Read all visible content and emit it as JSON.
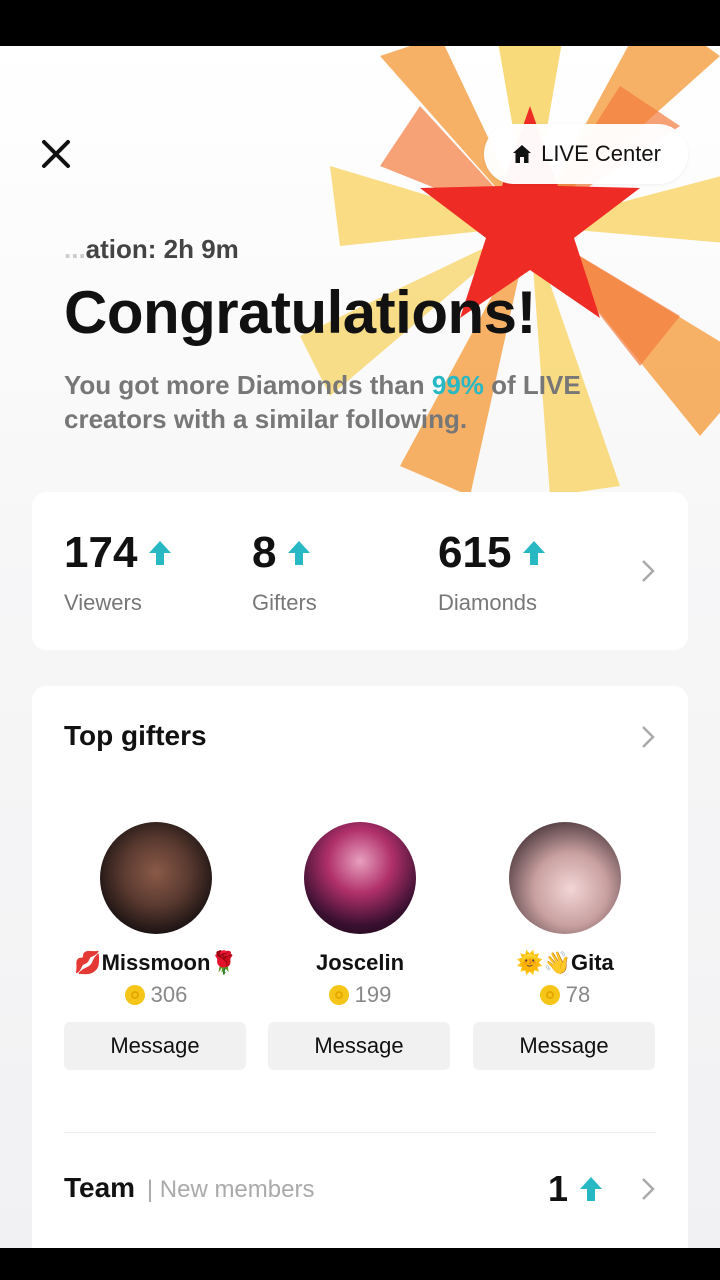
{
  "header": {
    "live_center_label": "LIVE Center",
    "duration_prefix_cut": "...",
    "duration_text": "ation: 2h 9m",
    "title": "Congratulations!",
    "subtitle_part1": "You got more Diamonds than ",
    "subtitle_pct": "99%",
    "subtitle_part2": " of LIVE creators with a similar following."
  },
  "stats": {
    "viewers": {
      "value": "174",
      "label": "Viewers"
    },
    "gifters": {
      "value": "8",
      "label": "Gifters"
    },
    "diamonds": {
      "value": "615",
      "label": "Diamonds"
    }
  },
  "top_gifters": {
    "title": "Top gifters",
    "items": [
      {
        "name": "💋Missmoon🌹",
        "coins": "306",
        "button": "Message"
      },
      {
        "name": "Joscelin",
        "coins": "199",
        "button": "Message"
      },
      {
        "name": "🌞👋Gita",
        "coins": "78",
        "button": "Message"
      }
    ]
  },
  "team": {
    "label": "Team",
    "sub": "| New members",
    "count": "1"
  },
  "colors": {
    "accent": "#27b8c4",
    "burst_red": "#ee2b24",
    "burst_orange": "#f6a34b",
    "burst_yellow": "#f8d66d"
  }
}
